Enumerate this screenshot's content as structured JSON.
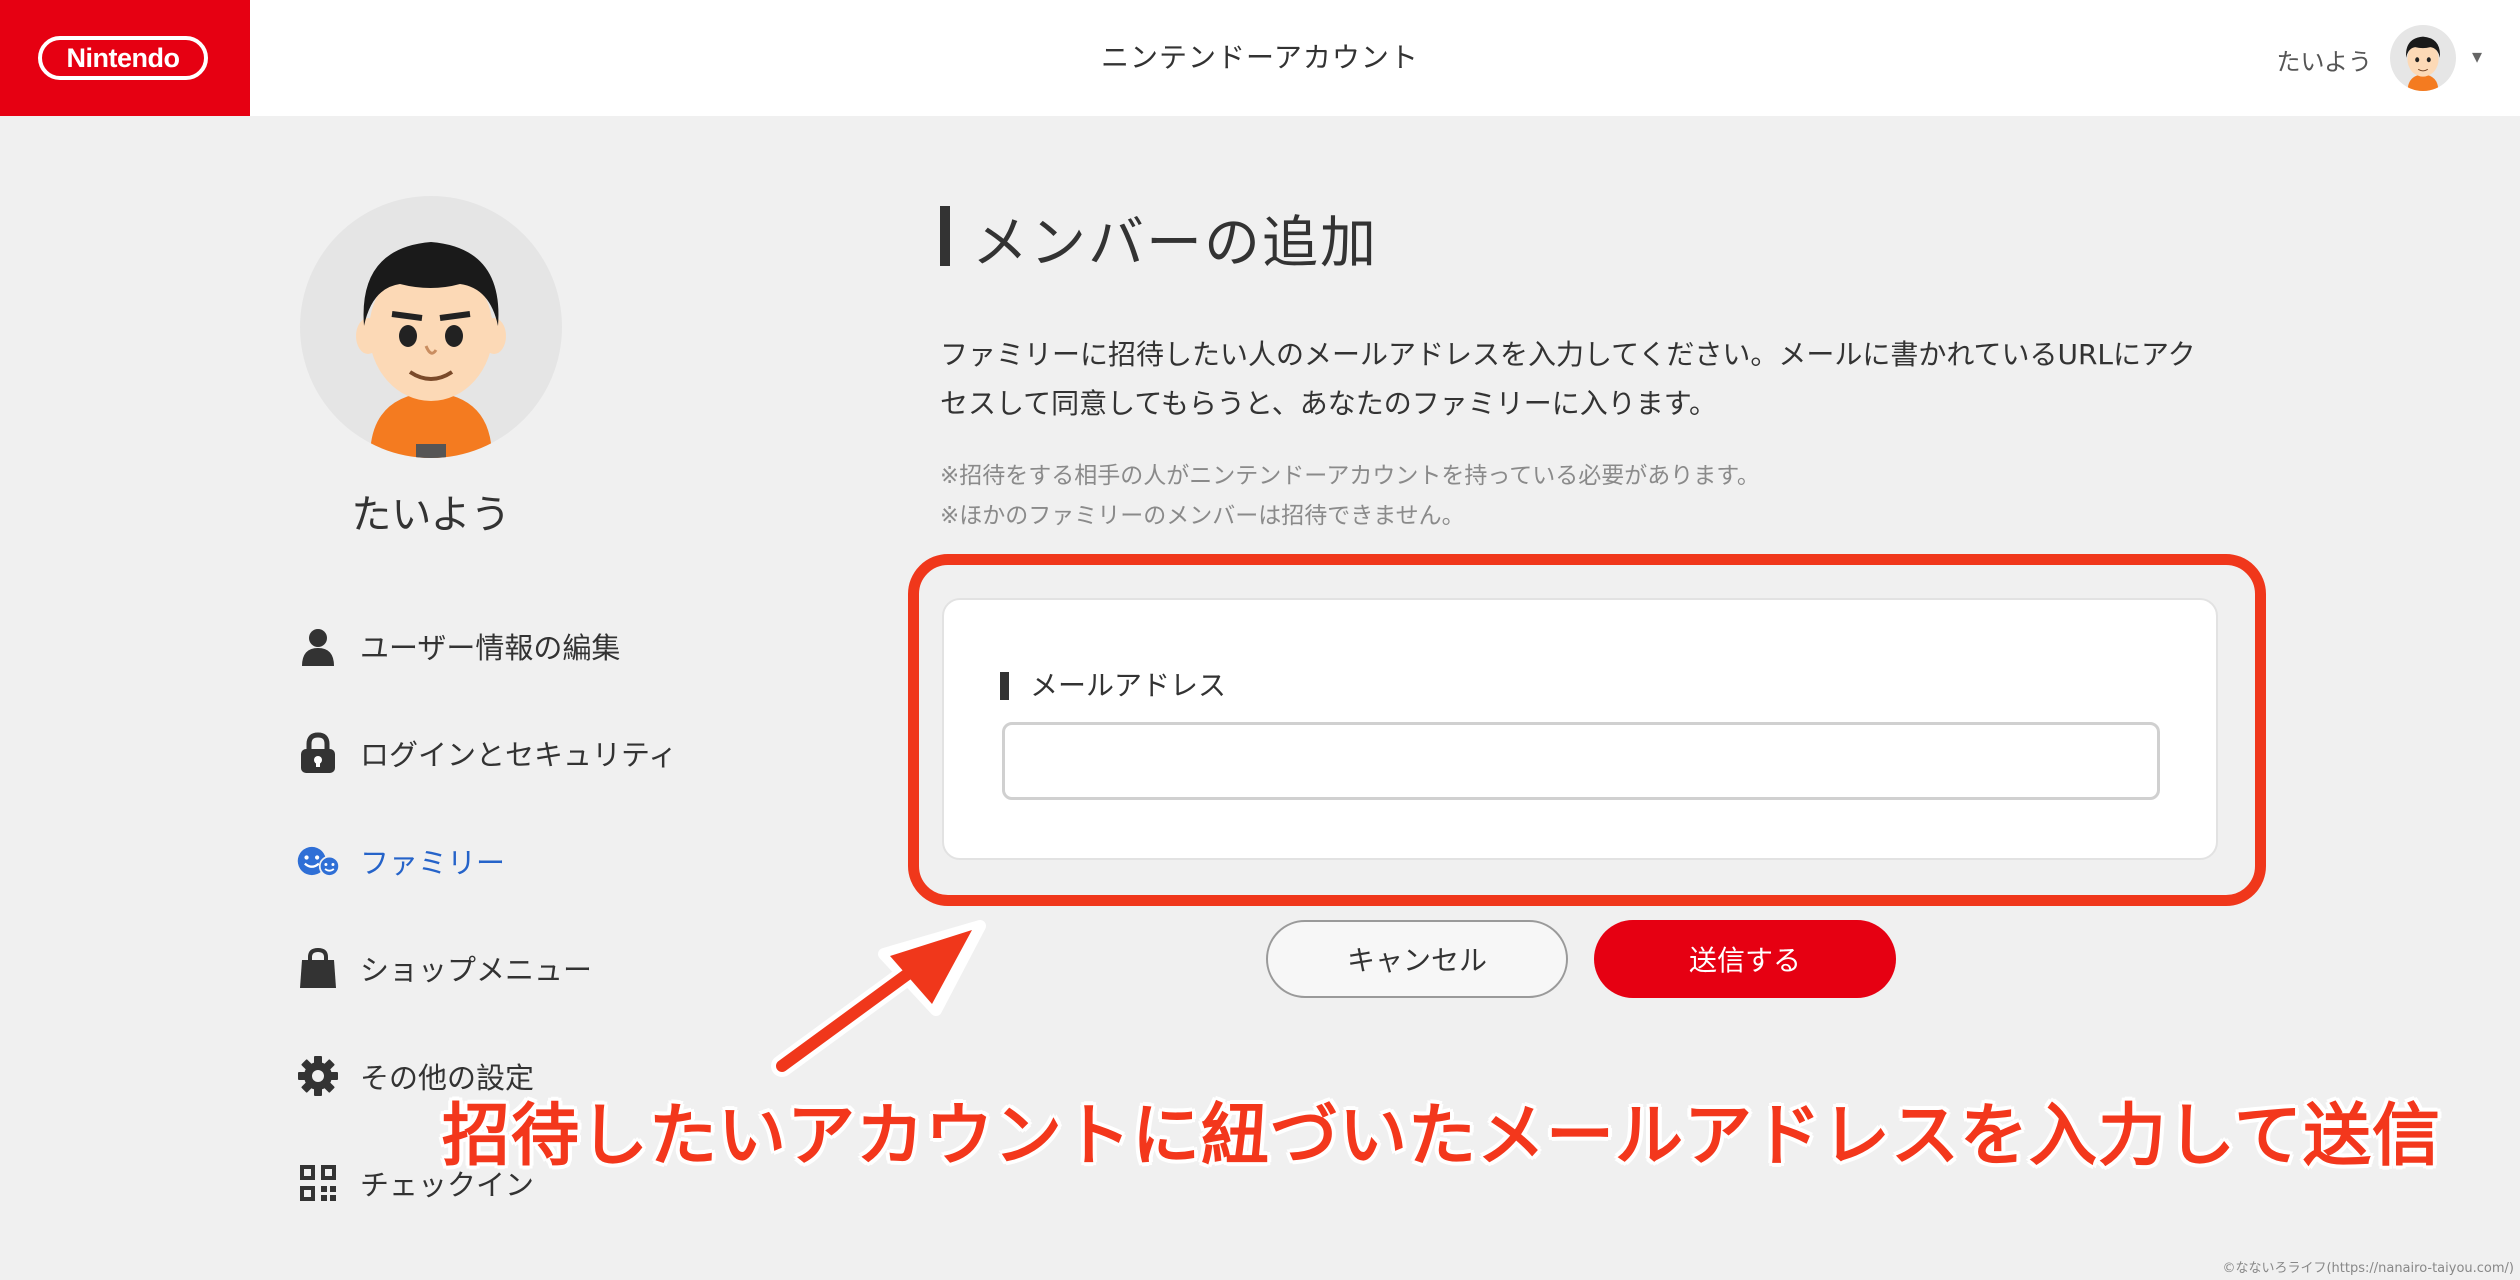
{
  "header": {
    "logo_text": "Nintendo",
    "title": "ニンテンドーアカウント",
    "username": "たいよう",
    "caret": "▾"
  },
  "sidebar": {
    "profile_name": "たいよう",
    "items": [
      {
        "label": "ユーザー情報の編集",
        "icon": "user-icon",
        "active": false
      },
      {
        "label": "ログインとセキュリティ",
        "icon": "lock-icon",
        "active": false
      },
      {
        "label": "ファミリー",
        "icon": "family-icon",
        "active": true
      },
      {
        "label": "ショップメニュー",
        "icon": "shopping-bag-icon",
        "active": false
      },
      {
        "label": "その他の設定",
        "icon": "gear-icon",
        "active": false
      },
      {
        "label": "チェックイン",
        "icon": "qr-code-icon",
        "active": false
      }
    ]
  },
  "main": {
    "title": "メンバーの追加",
    "description_line1": "ファミリーに招待したい人のメールアドレスを入力してください。メールに書かれているURLにアク",
    "description_line2": "セスして同意してもらうと、あなたのファミリーに入ります。",
    "note1": "※招待をする相手の人がニンテンドーアカウントを持っている必要があります。",
    "note2": "※ほかのファミリーのメンバーは招待できません。",
    "email_label": "メールアドレス",
    "email_value": "",
    "cancel_label": "キャンセル",
    "submit_label": "送信する"
  },
  "annotation": {
    "text": "招待したいアカウントに紐づいたメールアドレスを入力して送信"
  },
  "watermark": "©なないろライフ(https://nanairo-taiyou.com/)",
  "colors": {
    "brand_red": "#e60012",
    "annotation_red": "#f0371b",
    "active_blue": "#2563c9"
  }
}
